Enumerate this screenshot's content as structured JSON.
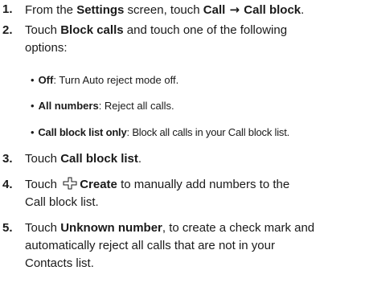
{
  "steps": [
    {
      "num": "1.",
      "lines": [
        [
          {
            "t": "From the ",
            "b": false
          },
          {
            "t": "Settings",
            "b": true
          },
          {
            "t": " screen, touch ",
            "b": false
          },
          {
            "t": "Call",
            "b": true
          },
          {
            "t": " → ",
            "b": true,
            "arrow": true
          },
          {
            "t": "Call block",
            "b": true
          },
          {
            "t": ".",
            "b": false
          }
        ]
      ]
    },
    {
      "num": "2.",
      "lines": [
        [
          {
            "t": "Touch ",
            "b": false
          },
          {
            "t": "Block calls",
            "b": true
          },
          {
            "t": " and touch one of the following",
            "b": false
          }
        ],
        [
          {
            "t": "options:",
            "b": false
          }
        ]
      ],
      "bullets": [
        {
          "term": "Off",
          "desc": ": Turn Auto reject mode off."
        },
        {
          "term": "All numbers",
          "desc": ": Reject all calls."
        },
        {
          "term": "Call block list only",
          "desc": ": Block all calls in your Call block list."
        }
      ]
    },
    {
      "num": "3.",
      "lines": [
        [
          {
            "t": "Touch ",
            "b": false
          },
          {
            "t": "Call block list",
            "b": true
          },
          {
            "t": ".",
            "b": false
          }
        ]
      ]
    },
    {
      "num": "4.",
      "lines": [
        [
          {
            "t": "Touch ",
            "b": false
          },
          {
            "icon": "create-icon"
          },
          {
            "t": "Create",
            "b": true
          },
          {
            "t": " to manually add numbers to the",
            "b": false
          }
        ],
        [
          {
            "t": "Call block list.",
            "b": false
          }
        ]
      ]
    },
    {
      "num": "5.",
      "lines": [
        [
          {
            "t": "Touch ",
            "b": false
          },
          {
            "t": "Unknown number",
            "b": true
          },
          {
            "t": ", to create a check mark and",
            "b": false
          }
        ],
        [
          {
            "t": "automatically reject all calls that are not in your",
            "b": false
          }
        ],
        [
          {
            "t": "Contacts list.",
            "b": false
          }
        ]
      ]
    }
  ],
  "bullet_char": "•"
}
